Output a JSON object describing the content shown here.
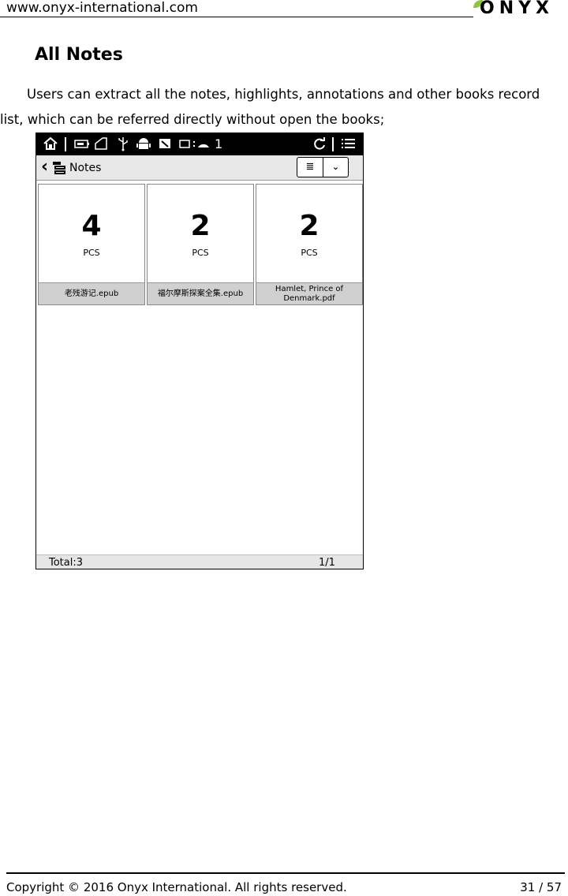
{
  "header": {
    "url": "www.onyx-international.com",
    "logo_text": "ONYX"
  },
  "section": {
    "title": "All Notes",
    "body": "Users can extract all the notes, highlights, annotations and other books record list, which can be referred directly without open the books;"
  },
  "device": {
    "status_bar": {
      "icons": [
        "home-icon",
        "battery-icon",
        "sd-card-icon",
        "usb-icon",
        "android-icon",
        "screenshot-icon",
        "wifi-icon",
        "refresh-icon",
        "menu-icon"
      ],
      "status_text": "1"
    },
    "nav": {
      "title": "Notes",
      "list_view_glyph": "≣",
      "dropdown_glyph": "⌄"
    },
    "cards": [
      {
        "count": "4",
        "unit": "PCS",
        "file": "老残游记.epub"
      },
      {
        "count": "2",
        "unit": "PCS",
        "file": "福尔摩斯探案全集.epub"
      },
      {
        "count": "2",
        "unit": "PCS",
        "file": "Hamlet, Prince of Denmark.pdf"
      }
    ],
    "footer": {
      "total": "Total:3",
      "page": "1/1"
    }
  },
  "footer": {
    "copyright": "Copyright © 2016 Onyx International. All rights reserved.",
    "page": "31 / 57"
  }
}
